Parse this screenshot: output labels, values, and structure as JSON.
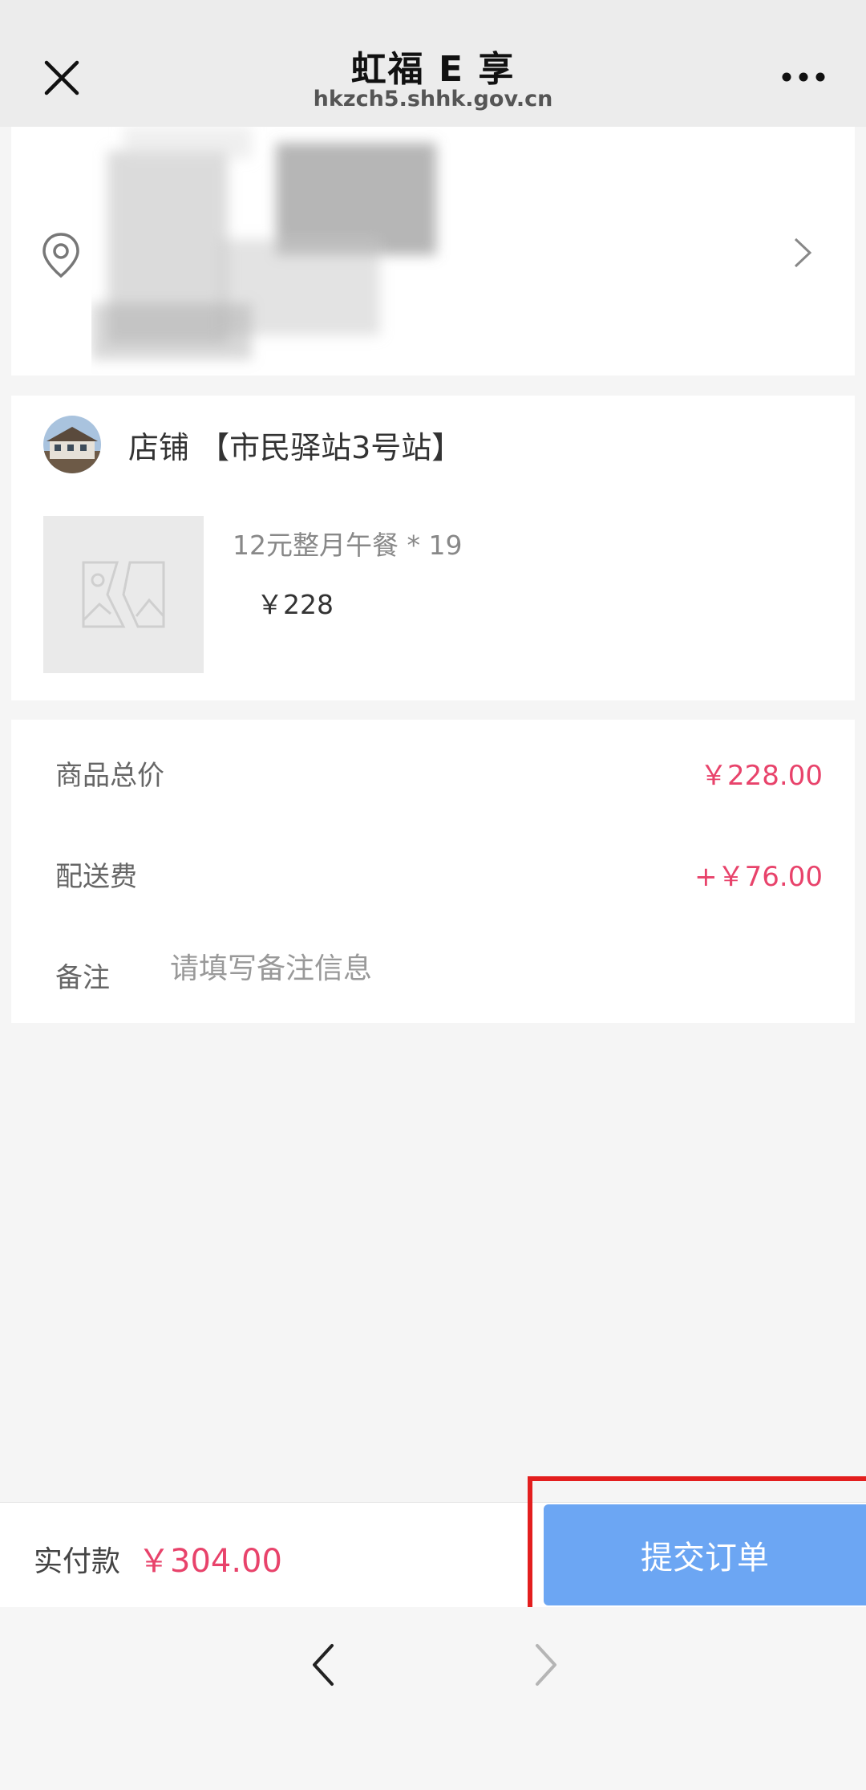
{
  "header": {
    "title": "虹福 E 享",
    "url": "hkzch5.shhk.gov.cn"
  },
  "shop": {
    "name": "店铺 【市民驿站3号站】"
  },
  "product": {
    "name": "12元整月午餐 * 19",
    "price": "￥228"
  },
  "summary": {
    "subtotal_label": "商品总价",
    "subtotal_value": "￥228.00",
    "delivery_label": "配送费",
    "delivery_value": "+￥76.00",
    "remark_label": "备注",
    "remark_placeholder": "请填写备注信息"
  },
  "footer": {
    "pay_label": "实付款",
    "pay_amount": "￥304.00",
    "submit_label": "提交订单"
  },
  "colors": {
    "accent_price": "#e8436b",
    "submit_button": "#6ca6f3",
    "highlight": "#e31e1e"
  },
  "icons": [
    "close-icon",
    "more-icon",
    "location-pin-icon",
    "chevron-right-icon",
    "image-placeholder-icon",
    "back-arrow-icon",
    "forward-arrow-icon"
  ]
}
